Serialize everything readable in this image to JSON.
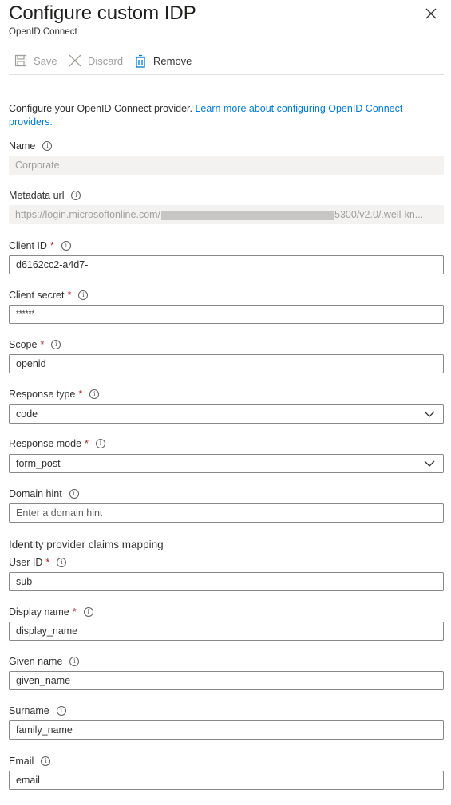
{
  "header": {
    "title": "Configure custom IDP",
    "subtitle": "OpenID Connect"
  },
  "toolbar": {
    "save_label": "Save",
    "discard_label": "Discard",
    "remove_label": "Remove"
  },
  "description": {
    "text": "Configure your OpenID Connect provider. ",
    "link": "Learn more about configuring OpenID Connect providers."
  },
  "fields": {
    "name": {
      "label": "Name",
      "value": "Corporate"
    },
    "metadata_url": {
      "label": "Metadata url",
      "value_prefix": "https://login.microsoftonline.com/",
      "value_suffix": "5300/v2.0/.well-kn..."
    },
    "client_id": {
      "label": "Client ID",
      "value": "d6162cc2-a4d7-"
    },
    "client_secret": {
      "label": "Client secret",
      "value": "******"
    },
    "scope": {
      "label": "Scope",
      "value": "openid"
    },
    "response_type": {
      "label": "Response type",
      "value": "code"
    },
    "response_mode": {
      "label": "Response mode",
      "value": "form_post"
    },
    "domain_hint": {
      "label": "Domain hint",
      "placeholder": "Enter a domain hint"
    }
  },
  "claims": {
    "heading": "Identity provider claims mapping",
    "user_id": {
      "label": "User ID",
      "value": "sub"
    },
    "display_name": {
      "label": "Display name",
      "value": "display_name"
    },
    "given_name": {
      "label": "Given name",
      "value": "given_name"
    },
    "surname": {
      "label": "Surname",
      "value": "family_name"
    },
    "email": {
      "label": "Email",
      "value": "email"
    }
  },
  "common": {
    "required_mark": "*",
    "info_glyph": "i"
  },
  "colors": {
    "link": "#0078d4",
    "required": "#a4262c",
    "border": "#8a8886"
  }
}
